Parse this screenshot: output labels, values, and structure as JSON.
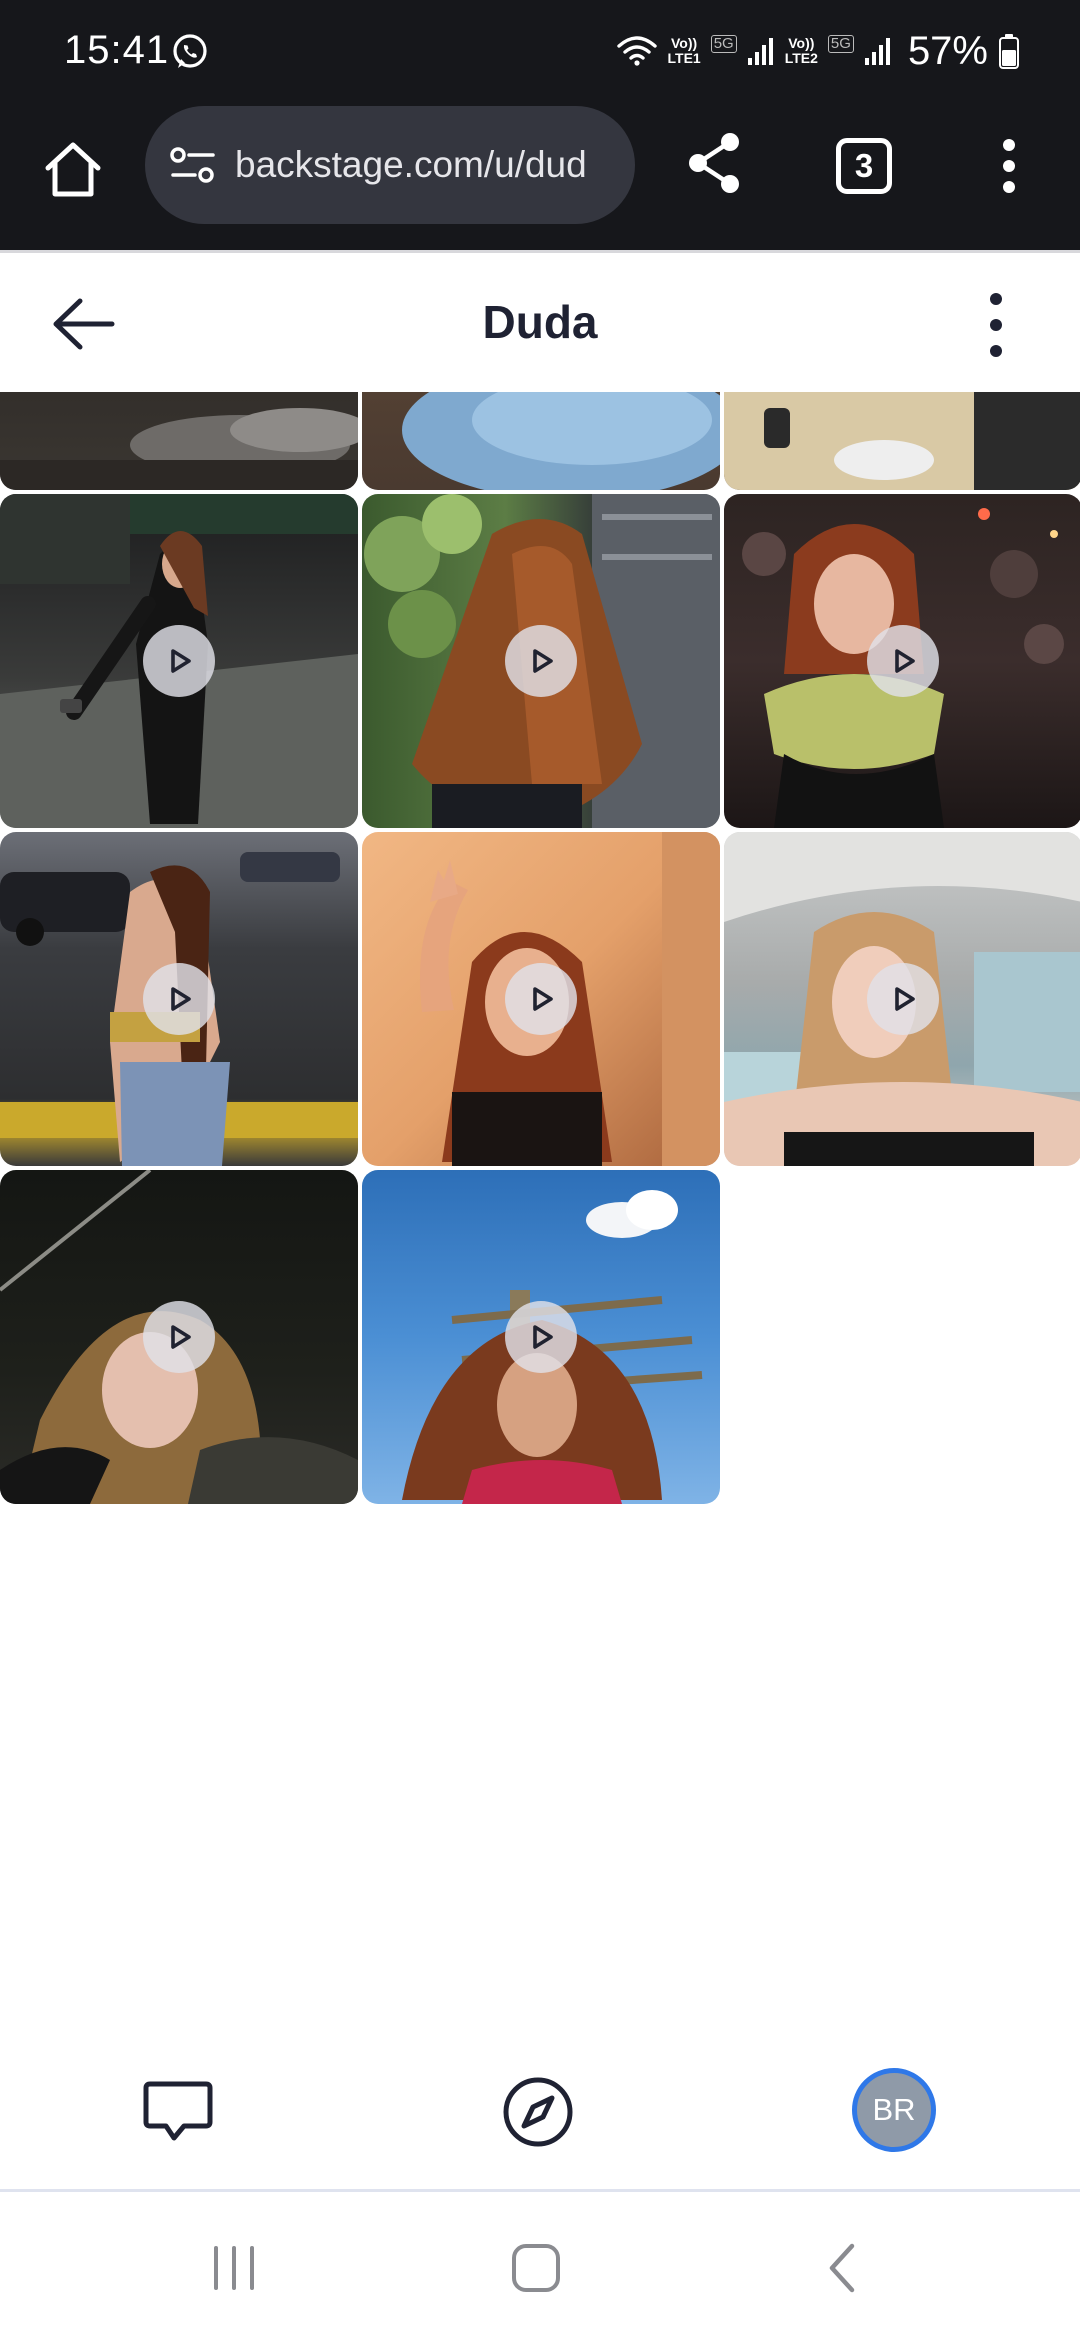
{
  "status_bar": {
    "time": "15:41",
    "sim1_label_top": "Vo))",
    "sim1_label_bottom": "LTE1",
    "sim2_label_top": "Vo))",
    "sim2_label_bottom": "LTE2",
    "network_badge": "5G",
    "battery": "57%",
    "icons": [
      "whatsapp-icon",
      "wifi-icon",
      "signal-icon",
      "battery-icon"
    ]
  },
  "browser": {
    "url": "backstage.com/u/dud",
    "tab_count": "3",
    "icons": [
      "home-icon",
      "tune-icon",
      "share-icon",
      "more-vertical-icon"
    ]
  },
  "header": {
    "title": "Duda",
    "icons": [
      "arrow-left-icon",
      "more-vertical-icon"
    ]
  },
  "media": {
    "play_icon": "play-icon",
    "rows": 4,
    "items": [
      {
        "type": "image",
        "scene": "partial top row"
      },
      {
        "type": "image",
        "scene": "partial top row"
      },
      {
        "type": "image",
        "scene": "partial top row"
      },
      {
        "type": "video"
      },
      {
        "type": "video"
      },
      {
        "type": "video"
      },
      {
        "type": "video"
      },
      {
        "type": "video"
      },
      {
        "type": "video"
      },
      {
        "type": "video"
      },
      {
        "type": "video"
      }
    ]
  },
  "bottom_nav": {
    "avatar_initials": "BR",
    "icons": [
      "chat-icon",
      "compass-icon"
    ]
  },
  "system_nav": {
    "icons": [
      "recent-apps-icon",
      "home-square-icon",
      "back-chevron-icon"
    ]
  }
}
